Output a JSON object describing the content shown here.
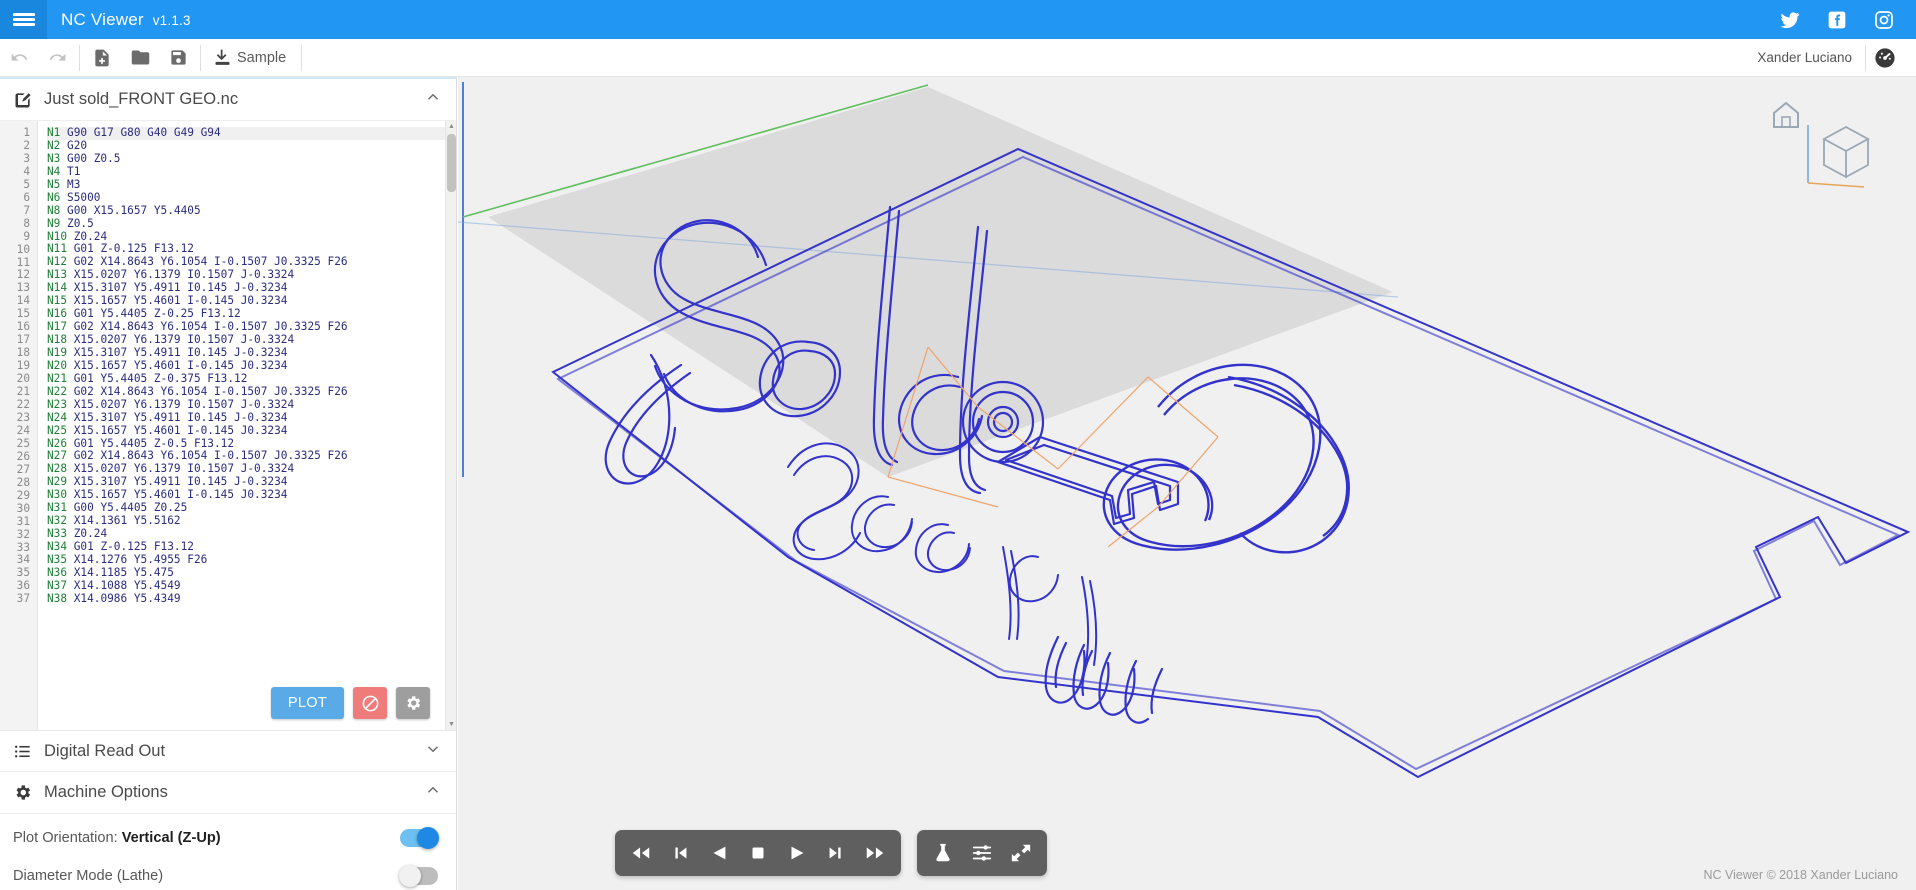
{
  "topbar": {
    "menu_icon": "hamburger-icon",
    "brand": "NC Viewer",
    "version": "v1.1.3",
    "social": [
      {
        "name": "twitter-icon",
        "label": "Twitter"
      },
      {
        "name": "facebook-icon",
        "label": "Facebook"
      },
      {
        "name": "instagram-icon",
        "label": "Instagram"
      }
    ]
  },
  "toolbar": {
    "undo_label": "Undo",
    "redo_label": "Redo",
    "new_label": "New File",
    "open_label": "Open File",
    "save_label": "Save File",
    "sample_label": "Sample",
    "user_name": "Xander Luciano",
    "avatar_icon": "dashboard-icon"
  },
  "file_panel": {
    "title": "Just sold_FRONT GEO.nc",
    "edit_icon": "edit-pencil-icon",
    "chevron": "chevron-up-icon",
    "collapsed": false,
    "active_line": 1,
    "lines": [
      "N1 G90 G17 G80 G40 G49 G94",
      "N2 G20",
      "N3 G00 Z0.5",
      "N4 T1",
      "N5 M3",
      "N6 S5000",
      "N8 G00 X15.1657 Y5.4405",
      "N9 Z0.5",
      "N10 Z0.24",
      "N11 G01 Z-0.125 F13.12",
      "N12 G02 X14.8643 Y6.1054 I-0.1507 J0.3325 F26",
      "N13 X15.0207 Y6.1379 I0.1507 J-0.3324",
      "N14 X15.3107 Y5.4911 I0.145 J-0.3234",
      "N15 X15.1657 Y5.4601 I-0.145 J0.3234",
      "N16 G01 Y5.4405 Z-0.25 F13.12",
      "N17 G02 X14.8643 Y6.1054 I-0.1507 J0.3325 F26",
      "N18 X15.0207 Y6.1379 I0.1507 J-0.3324",
      "N19 X15.3107 Y5.4911 I0.145 J-0.3234",
      "N20 X15.1657 Y5.4601 I-0.145 J0.3234",
      "N21 G01 Y5.4405 Z-0.375 F13.12",
      "N22 G02 X14.8643 Y6.1054 I-0.1507 J0.3325 F26",
      "N23 X15.0207 Y6.1379 I0.1507 J-0.3324",
      "N24 X15.3107 Y5.4911 I0.145 J-0.3234",
      "N25 X15.1657 Y5.4601 I-0.145 J0.3234",
      "N26 G01 Y5.4405 Z-0.5 F13.12",
      "N27 G02 X14.8643 Y6.1054 I-0.1507 J0.3325 F26",
      "N28 X15.0207 Y6.1379 I0.1507 J-0.3324",
      "N29 X15.3107 Y5.4911 I0.145 J-0.3234",
      "N30 X15.1657 Y5.4601 I-0.145 J0.3234",
      "N31 G00 Y5.4405 Z0.25",
      "N32 X14.1361 Y5.5162",
      "N33 Z0.24",
      "N34 G01 Z-0.125 F13.12",
      "N35 X14.1276 Y5.4955 F26",
      "N36 X14.1185 Y5.475",
      "N37 X14.1088 Y5.4549",
      "N38 X14.0986 Y5.4349"
    ],
    "buttons": {
      "plot_label": "PLOT",
      "stop_icon": "no-entry-icon",
      "settings_icon": "gear-icon"
    }
  },
  "dro_panel": {
    "title": "Digital Read Out",
    "icon": "list-icon",
    "chevron": "chevron-down-icon",
    "collapsed": true
  },
  "machine_panel": {
    "title": "Machine Options",
    "icon": "gear-icon",
    "chevron": "chevron-up-icon",
    "collapsed": false,
    "options": [
      {
        "name": "plot-orientation",
        "label_prefix": "Plot Orientation: ",
        "label_value": "Vertical (Z-Up)",
        "state": "on"
      },
      {
        "name": "diameter-mode",
        "label_prefix": "Diameter Mode (Lathe)",
        "label_value": "",
        "state": "off"
      }
    ]
  },
  "viewport": {
    "axis_cube_icon": "view-cube-icon",
    "home_icon": "home-icon",
    "toolpath_color": "#3333cc",
    "rapid_color": "#f0a36a",
    "stock_color": "#d8d8d8",
    "background": "#f0f0f0"
  },
  "playback": {
    "controls": [
      {
        "name": "rewind-to-start-button",
        "icon": "skip-backward-icon"
      },
      {
        "name": "step-backward-button",
        "icon": "previous-icon"
      },
      {
        "name": "play-reverse-button",
        "icon": "play-reverse-icon"
      },
      {
        "name": "stop-button",
        "icon": "stop-icon"
      },
      {
        "name": "play-button",
        "icon": "play-icon"
      },
      {
        "name": "step-forward-button",
        "icon": "next-icon"
      },
      {
        "name": "fast-forward-to-end-button",
        "icon": "skip-forward-icon"
      }
    ],
    "tools": [
      {
        "name": "simulation-button",
        "icon": "flask-icon"
      },
      {
        "name": "settings-sliders-button",
        "icon": "sliders-icon"
      },
      {
        "name": "fullscreen-button",
        "icon": "expand-arrows-icon"
      }
    ]
  },
  "footer": {
    "credit": "NC Viewer © 2018 Xander Luciano"
  }
}
